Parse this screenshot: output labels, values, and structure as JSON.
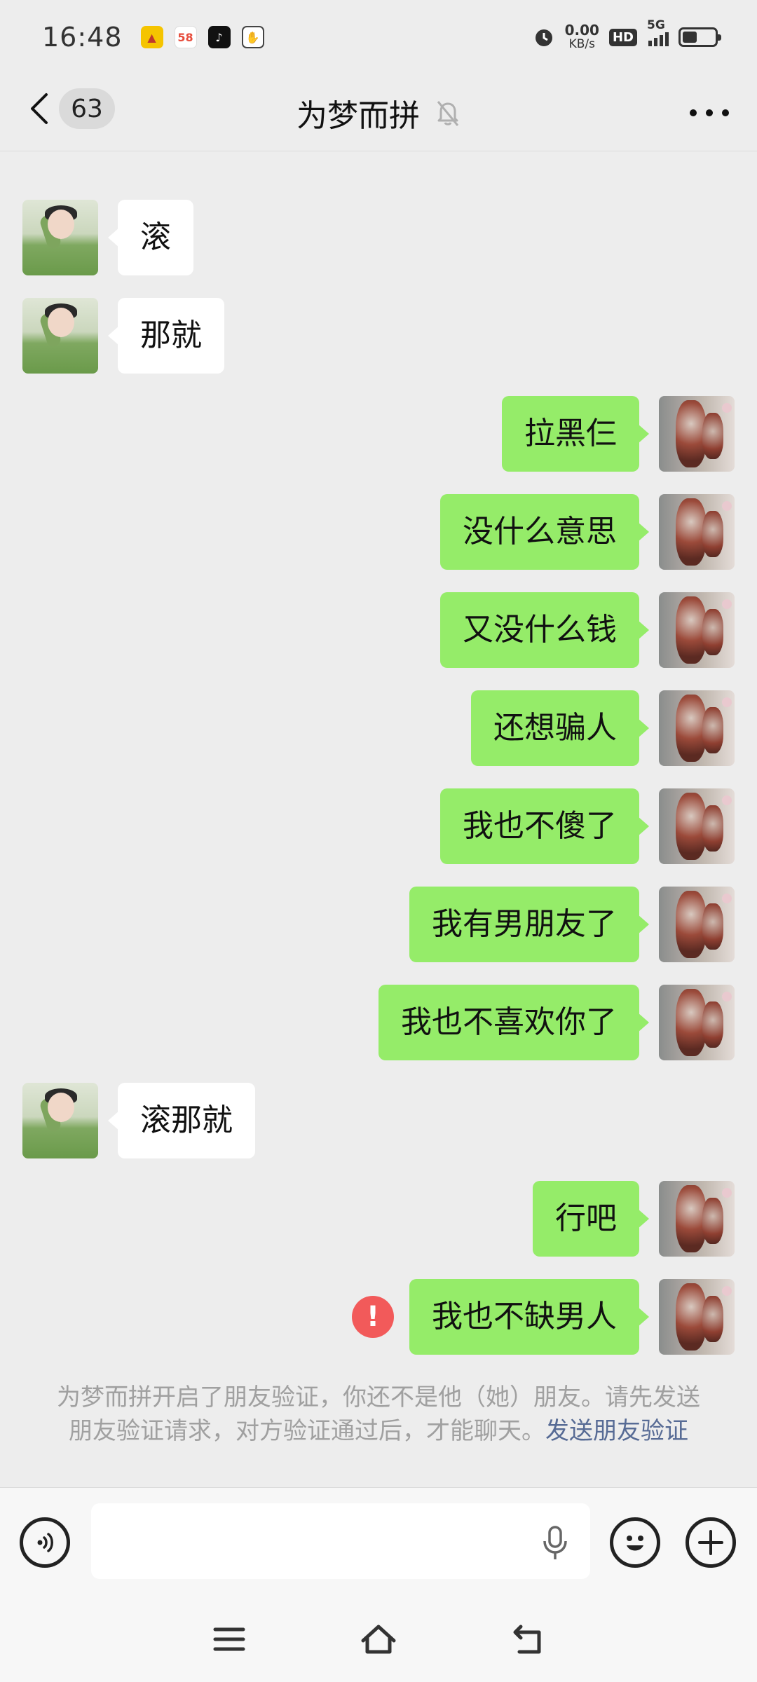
{
  "status_bar": {
    "time": "16:48",
    "net_speed_value": "0.00",
    "net_speed_unit": "KB/s",
    "hd_label": "HD",
    "network_label": "5G"
  },
  "header": {
    "unread_count": "63",
    "title": "为梦而拼"
  },
  "messages": [
    {
      "side": "left",
      "text": "滚"
    },
    {
      "side": "left",
      "text": "那就"
    },
    {
      "side": "right",
      "text": "拉黑仨"
    },
    {
      "side": "right",
      "text": "没什么意思"
    },
    {
      "side": "right",
      "text": "又没什么钱"
    },
    {
      "side": "right",
      "text": "还想骗人"
    },
    {
      "side": "right",
      "text": "我也不傻了"
    },
    {
      "side": "right",
      "text": "我有男朋友了"
    },
    {
      "side": "right",
      "text": "我也不喜欢你了"
    },
    {
      "side": "left",
      "text": "滚那就"
    },
    {
      "side": "right",
      "text": "行吧"
    },
    {
      "side": "right",
      "text": "我也不缺男人",
      "failed": true
    }
  ],
  "system_note": {
    "text": "为梦而拼开启了朋友验证，你还不是他（她）朋友。请先发送朋友验证请求，对方验证通过后，才能聊天。",
    "link": "发送朋友验证"
  },
  "input_bar": {
    "placeholder": ""
  },
  "colors": {
    "background": "#ededed",
    "my_bubble": "#95ec69",
    "their_bubble": "#ffffff",
    "error": "#f25a5a",
    "link": "#576b95"
  },
  "icons": {
    "status_apps": [
      "app-icon-yellow",
      "app-icon-58",
      "app-icon-tiktok",
      "app-icon-hand"
    ],
    "header": [
      "back-icon",
      "mute-icon",
      "more-icon"
    ],
    "input": [
      "voice-icon",
      "mic-icon",
      "emoji-icon",
      "plus-icon"
    ],
    "system_nav": [
      "menu-icon",
      "home-icon",
      "back-nav-icon"
    ]
  }
}
